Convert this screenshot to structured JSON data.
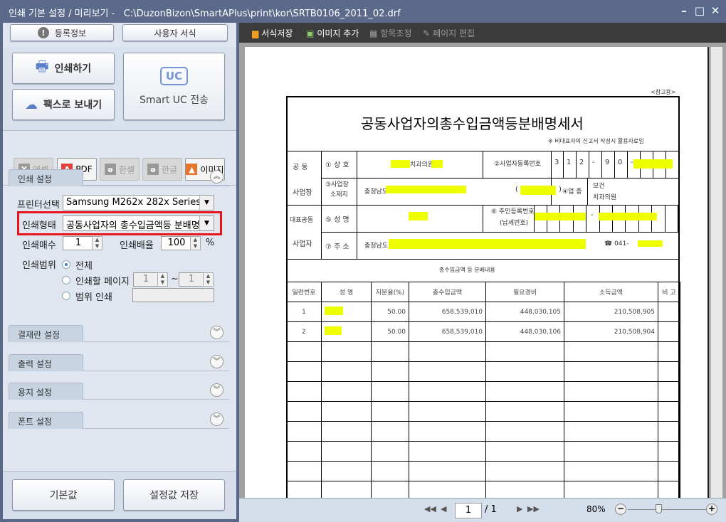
{
  "window": {
    "title": "인쇄 기본 설정 / 미리보기 -   C:\\DuzonBizon\\SmartAPlus\\print\\kor\\SRTB0106_2011_02.drf"
  },
  "left": {
    "reg_info": "등록정보",
    "user_format": "사용자 서식",
    "print": "인쇄하기",
    "fax": "팩스로 보내기",
    "uc_label": "UC",
    "smart_uc": "Smart UC 전송",
    "export": [
      "엑셀",
      "PDF",
      "한셀",
      "한글",
      "이미지"
    ],
    "print_settings": {
      "section": "인쇄 설정",
      "printer_label": "프린터선택",
      "printer_value": "Samsung M262x 282x Series",
      "type_label": "인쇄형태",
      "type_value": "공동사업자의 총수입금액등 분배명",
      "copies_label": "인쇄매수",
      "copies_value": "1",
      "scale_label": "인쇄배율",
      "scale_value": "100",
      "scale_unit": "%",
      "range_label": "인쇄범위",
      "range_all": "전체",
      "range_pages": "인쇄할 페이지",
      "page_from": "1",
      "tilde": "~",
      "page_to": "1",
      "range_custom": "범위 인쇄",
      "range_custom_value": ""
    },
    "sections": [
      "결재란 설정",
      "출력 설정",
      "용지 설정",
      "폰트 설정"
    ],
    "default": "기본값",
    "save_settings": "설정값 저장"
  },
  "toolbar": {
    "save_format": "서식저장",
    "add_image": "이미지 추가",
    "adjust_items": "항목조정",
    "edit_page": "페이지 편집"
  },
  "document": {
    "ref": "<참고용>",
    "title": "공동사업자의총수입금액등분배명세서",
    "note": "※ 비대표자의 신고서 작성시 활용자료임",
    "joint_biz_1": "공  동",
    "joint_biz_2": "사업장",
    "rep_1": "대표공동",
    "rep_2": "사업자",
    "f1": "① 상  호",
    "f1_value": "치과의원",
    "f2": "②사업자등록번호",
    "f2_digits": [
      "3",
      "1",
      "2",
      "-",
      "9",
      "0",
      "-"
    ],
    "f3a": "③사업장",
    "f3b": "소재지",
    "f3_value": "충청남도",
    "f3_paren_open": "(",
    "f3_paren_close": ")",
    "f4": "④업  종",
    "f4_value1": "보건",
    "f4_value2": "치과의원",
    "f5": "⑤ 성  명",
    "f6a": "⑥ 주민등록번호",
    "f6b": "(납세번호)",
    "f6_dash": "-",
    "f7": "⑦ 주  소",
    "f7_value": "충청남도",
    "phone": "☎  041-",
    "dist_title": "총수입금액 등 분배내용",
    "headers": [
      "일련번호",
      "성  명",
      "지분율(%)",
      "총수입금액",
      "필요경비",
      "소득금액",
      "비 고"
    ],
    "rows": [
      [
        "1",
        "",
        "50.00",
        "658,539,010",
        "448,030,105",
        "210,508,905",
        ""
      ],
      [
        "2",
        "",
        "50.00",
        "658,539,010",
        "448,030,106",
        "210,508,904",
        ""
      ]
    ]
  },
  "pager": {
    "page": "1",
    "total": "/ 1",
    "zoom": "80%",
    "zoom_fraction": 0.4
  }
}
